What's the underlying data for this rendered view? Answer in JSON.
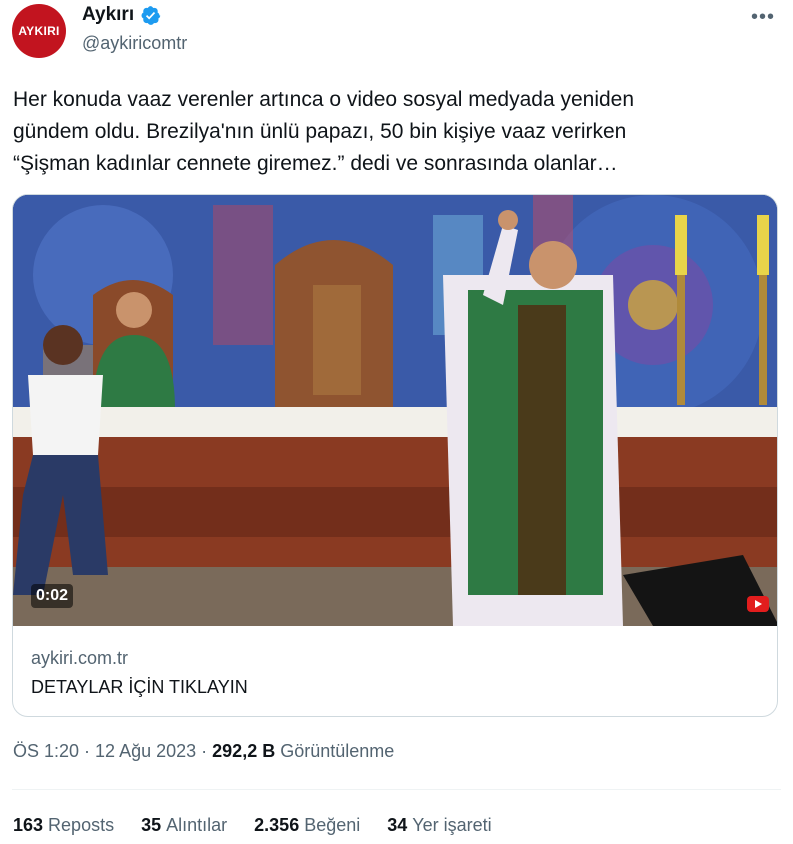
{
  "author": {
    "avatar_text": "AYKIRI",
    "display_name": "Aykırı",
    "handle": "@aykiricomtr",
    "avatar_color": "#c2141f",
    "verified_color": "#1d9bf0"
  },
  "more_label": "•••",
  "tweet_text": "Her konuda vaaz verenler artınca o video sosyal medyada yeniden\ngündem oldu. Brezilya'nın ünlü papazı, 50 bin kişiye vaaz verirken\n“Şişman kadınlar cennete giremez.” dedi ve sonrasında olanlar…",
  "card": {
    "duration": "0:02",
    "domain": "aykiri.com.tr",
    "title": "DETAYLAR İÇİN TIKLAYIN"
  },
  "meta": {
    "time": "ÖS 1:20",
    "separator": "·",
    "date": "12 Ağu 2023",
    "views_count": "292,2 B",
    "views_label": "Görüntülenme"
  },
  "stats": [
    {
      "count": "163",
      "label": "Reposts"
    },
    {
      "count": "35",
      "label": "Alıntılar"
    },
    {
      "count": "2.356",
      "label": "Beğeni"
    },
    {
      "count": "34",
      "label": "Yer işareti"
    }
  ],
  "icons": {
    "verified": "verified-badge-icon",
    "more": "more-icon",
    "video_source": "youtube-icon"
  }
}
